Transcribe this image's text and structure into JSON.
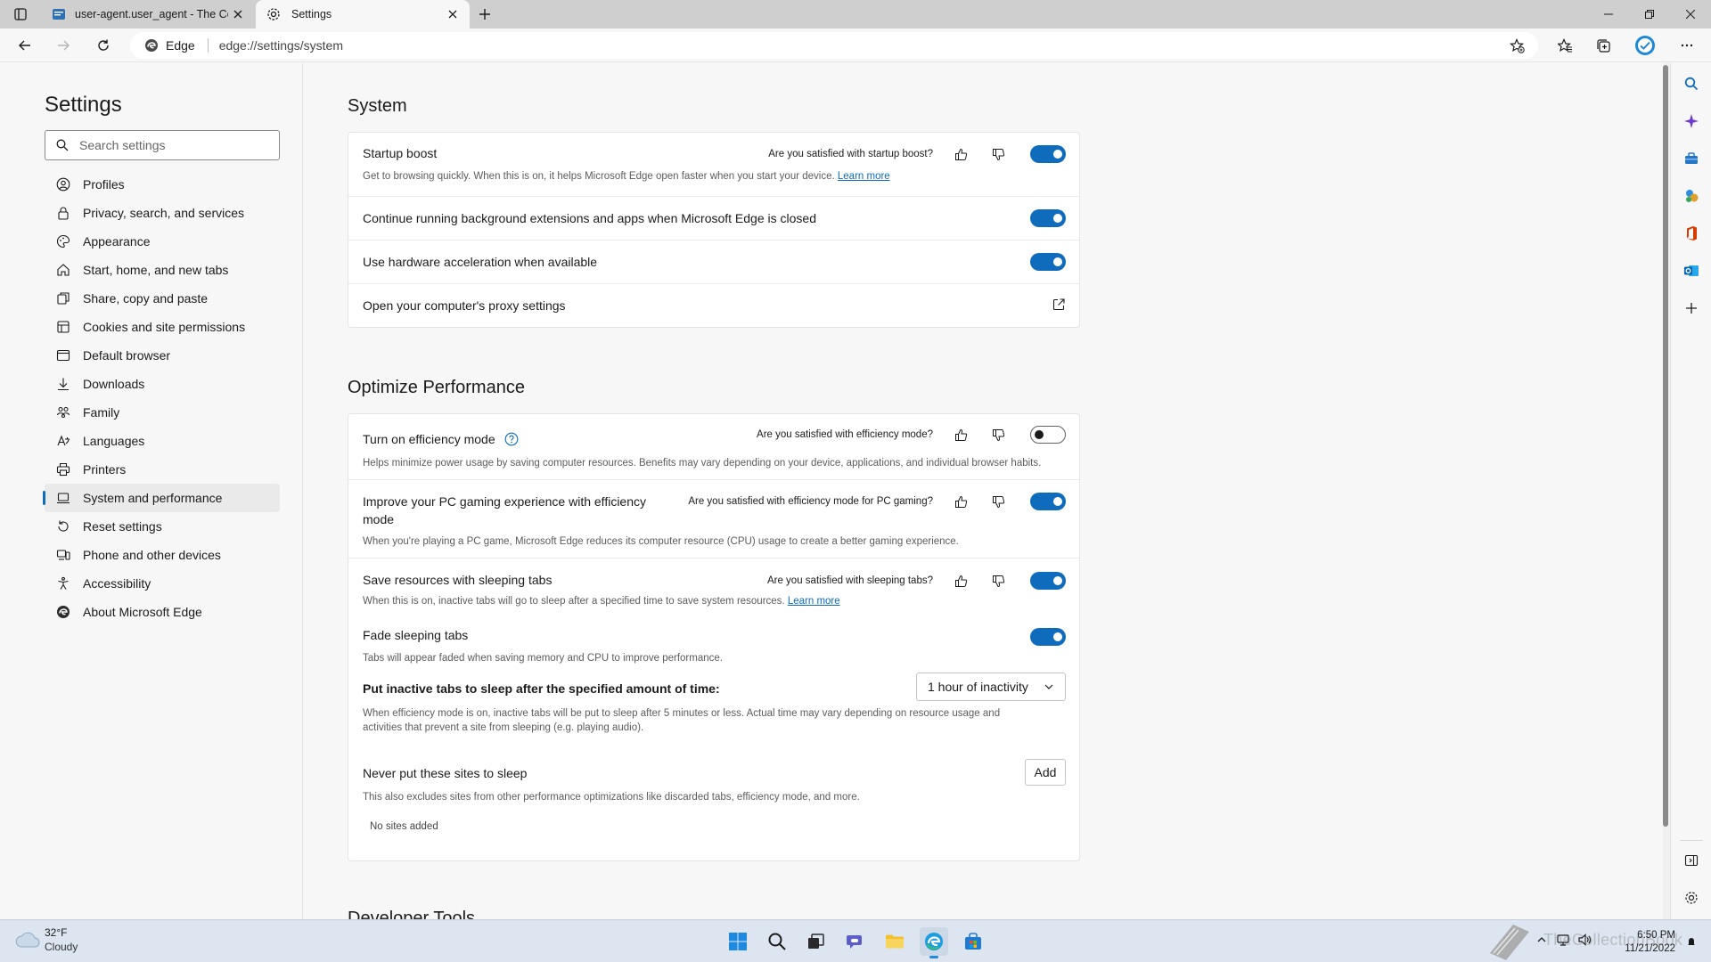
{
  "browser": {
    "tabs": [
      {
        "title": "user-agent.user_agent - The Col"
      },
      {
        "title": "Settings"
      }
    ],
    "address": {
      "identity": "Edge",
      "url": "edge://settings/system"
    }
  },
  "settings": {
    "title": "Settings",
    "search_placeholder": "Search settings",
    "nav": [
      {
        "label": "Profiles",
        "icon": "profile-icon"
      },
      {
        "label": "Privacy, search, and services",
        "icon": "lock-icon"
      },
      {
        "label": "Appearance",
        "icon": "palette-icon"
      },
      {
        "label": "Start, home, and new tabs",
        "icon": "home-icon"
      },
      {
        "label": "Share, copy and paste",
        "icon": "share-icon"
      },
      {
        "label": "Cookies and site permissions",
        "icon": "cookie-icon"
      },
      {
        "label": "Default browser",
        "icon": "browser-icon"
      },
      {
        "label": "Downloads",
        "icon": "download-icon"
      },
      {
        "label": "Family",
        "icon": "family-icon"
      },
      {
        "label": "Languages",
        "icon": "language-icon"
      },
      {
        "label": "Printers",
        "icon": "printer-icon"
      },
      {
        "label": "System and performance",
        "icon": "laptop-icon",
        "selected": true
      },
      {
        "label": "Reset settings",
        "icon": "reset-icon"
      },
      {
        "label": "Phone and other devices",
        "icon": "phone-icon"
      },
      {
        "label": "Accessibility",
        "icon": "accessibility-icon"
      },
      {
        "label": "About Microsoft Edge",
        "icon": "edge-logo-icon"
      }
    ]
  },
  "system": {
    "heading": "System",
    "startup_boost": {
      "title": "Startup boost",
      "desc": "Get to browsing quickly. When this is on, it helps Microsoft Edge open faster when you start your device.",
      "link": "Learn more",
      "feedback": "Are you satisfied with startup boost?",
      "enabled": true
    },
    "background_apps": {
      "title": "Continue running background extensions and apps when Microsoft Edge is closed",
      "enabled": true
    },
    "hardware_accel": {
      "title": "Use hardware acceleration when available",
      "enabled": true
    },
    "proxy": {
      "title": "Open your computer's proxy settings"
    }
  },
  "performance": {
    "heading": "Optimize Performance",
    "efficiency": {
      "title": "Turn on efficiency mode",
      "desc": "Helps minimize power usage by saving computer resources. Benefits may vary depending on your device, applications, and individual browser habits.",
      "feedback": "Are you satisfied with efficiency mode?",
      "enabled": false
    },
    "gaming": {
      "title_line1": "Improve your PC gaming experience with efficiency",
      "title_line2": "mode",
      "desc": "When you're playing a PC game, Microsoft Edge reduces its computer resource (CPU) usage to create a better gaming experience.",
      "feedback": "Are you satisfied with efficiency mode for PC gaming?",
      "enabled": true
    },
    "sleeping_tabs": {
      "title": "Save resources with sleeping tabs",
      "desc": "When this is on, inactive tabs will go to sleep after a specified time to save system resources.",
      "link": "Learn more",
      "feedback": "Are you satisfied with sleeping tabs?",
      "enabled": true
    },
    "fade_tabs": {
      "title": "Fade sleeping tabs",
      "desc": "Tabs will appear faded when saving memory and CPU to improve performance.",
      "enabled": true
    },
    "inactive_sleep": {
      "title": "Put inactive tabs to sleep after the specified amount of time:",
      "selected": "1 hour of inactivity",
      "desc_line1": "When efficiency mode is on, inactive tabs will be put to sleep after 5 minutes or less. Actual time may vary depending on resource usage and",
      "desc_line2": "activities that prevent a site from sleeping (e.g. playing audio)."
    },
    "never_sleep": {
      "title": "Never put these sites to sleep",
      "button": "Add",
      "desc": "This also excludes sites from other performance optimizations like discarded tabs, efficiency mode, and more.",
      "empty": "No sites added"
    }
  },
  "next_heading": "Developer Tools",
  "taskbar": {
    "weather_temp": "32°F",
    "weather_cond": "Cloudy",
    "time": "6:50 PM",
    "date": "11/21/2022",
    "watermark": "TheCollectionBook"
  },
  "colors": {
    "accent": "#0f6cbd",
    "taskbar": "#dde6f0"
  }
}
